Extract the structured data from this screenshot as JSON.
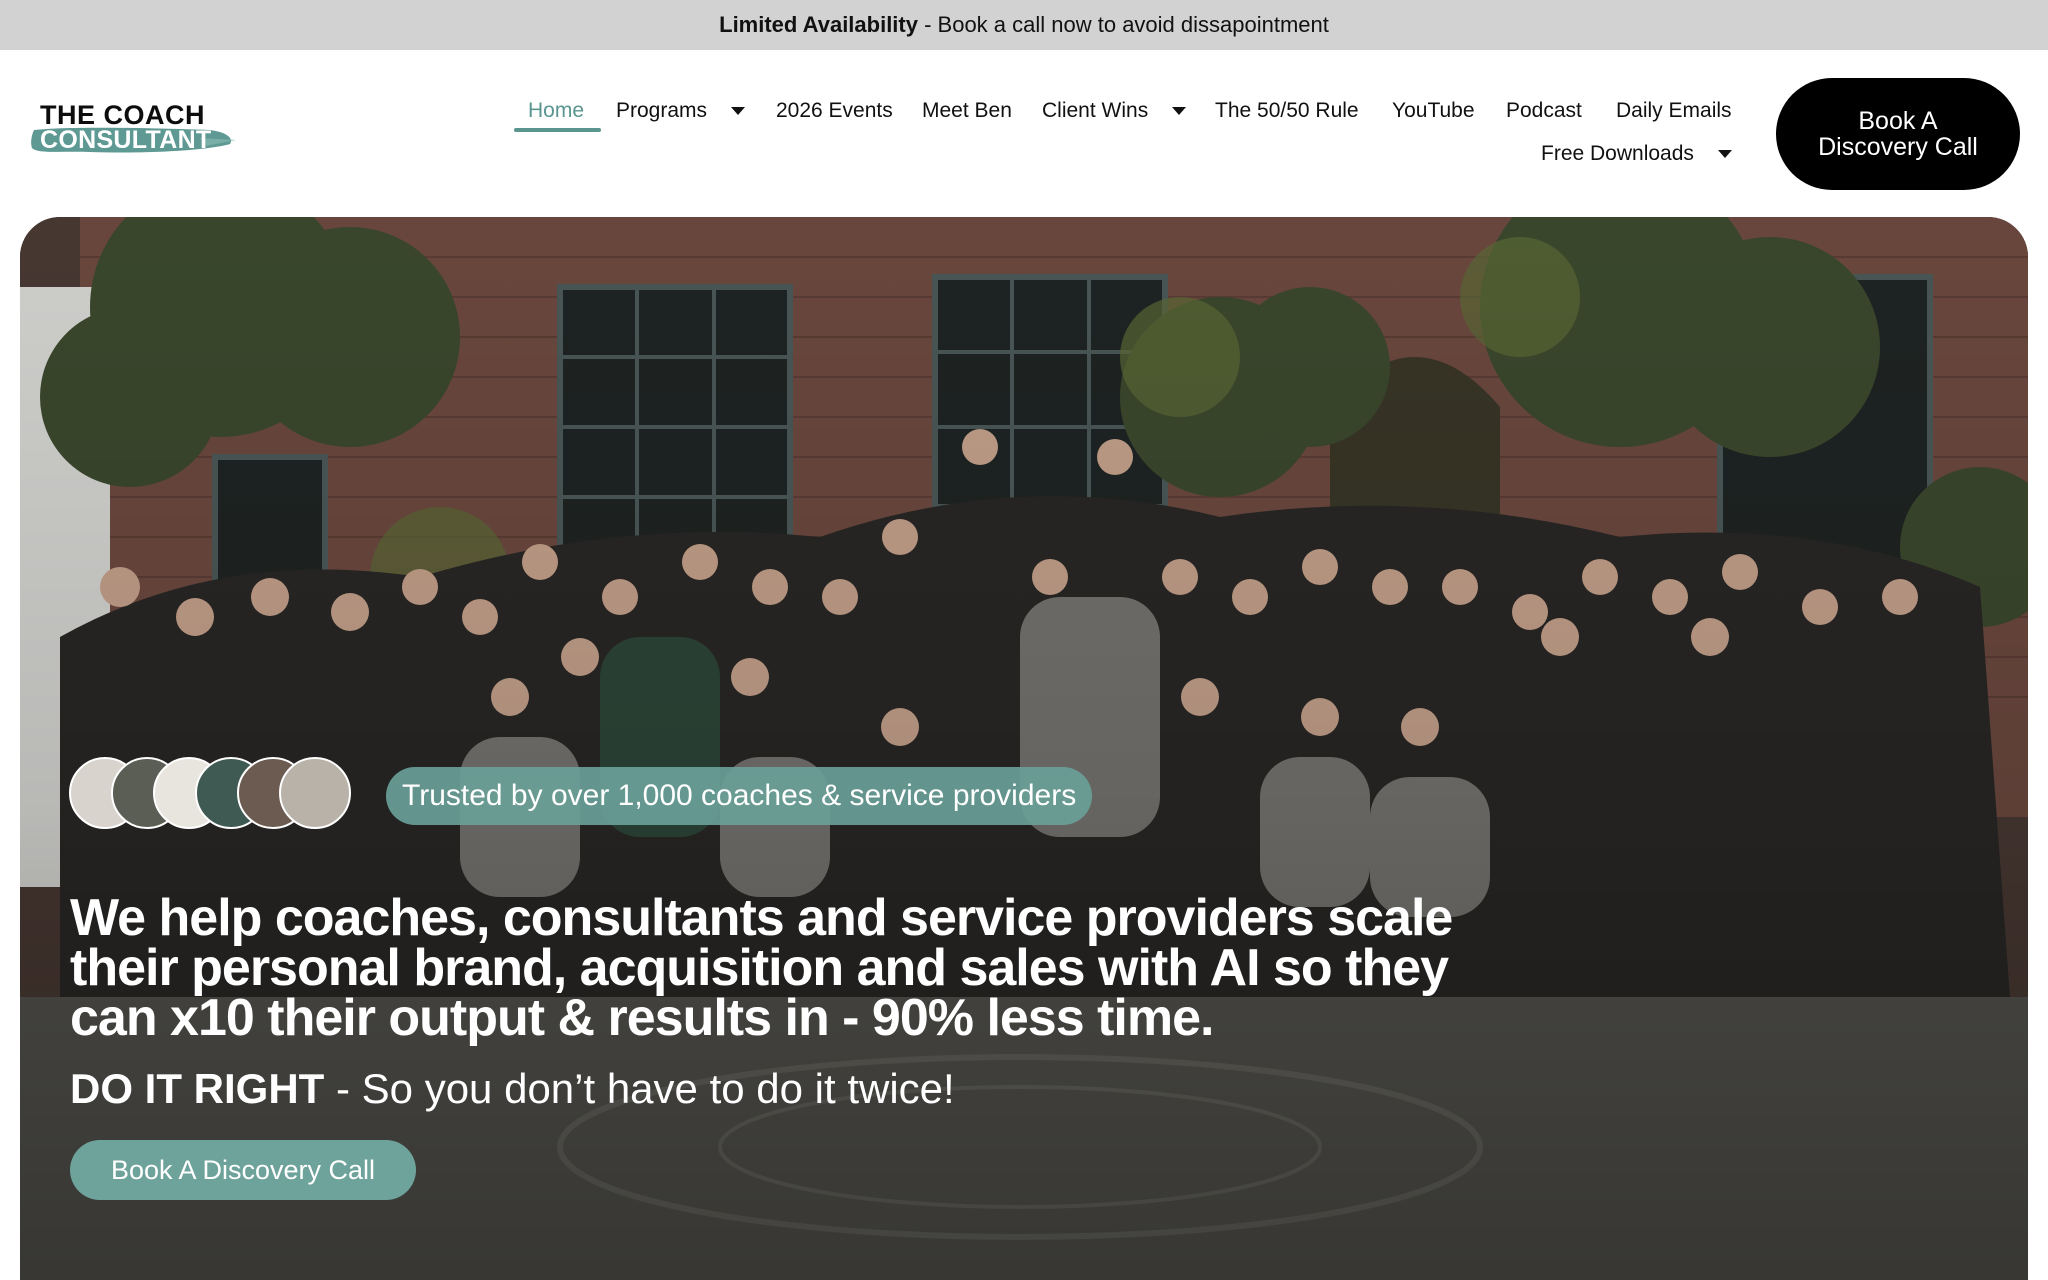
{
  "announcement": {
    "bold": "Limited Availability",
    "rest": " - Book a call now to avoid dissapointment"
  },
  "logo": {
    "line1": "THE COACH",
    "line2": "CONSULTANT"
  },
  "nav": {
    "items": [
      {
        "label": "Home",
        "active": true
      },
      {
        "label": "Programs",
        "dropdown": true
      },
      {
        "label": "2026 Events"
      },
      {
        "label": "Meet Ben"
      },
      {
        "label": "Client Wins",
        "dropdown": true
      },
      {
        "label": "The 50/50 Rule"
      },
      {
        "label": "YouTube"
      },
      {
        "label": "Podcast"
      },
      {
        "label": "Daily Emails"
      },
      {
        "label": "Free Downloads",
        "dropdown": true
      }
    ],
    "cta": "Book A Discovery Call"
  },
  "hero": {
    "trusted": "Trusted by over 1,000 coaches & service providers",
    "headline_1": "We help coaches, consultants and service providers ",
    "headline_bold_1": "scale their personal brand, acquisition and sales with AI",
    "headline_2": " so they can x10 their output & results in - 90% less time.",
    "tagline_bold": "DO IT RIGHT",
    "tagline_rest": " - So you don’t have to do it twice!",
    "cta": "Book A Discovery Call"
  },
  "colors": {
    "accent": "#5a9590",
    "cta_hero": "#6ea39b",
    "topbar": "#d2d2d2",
    "cta_top": "#000000"
  }
}
